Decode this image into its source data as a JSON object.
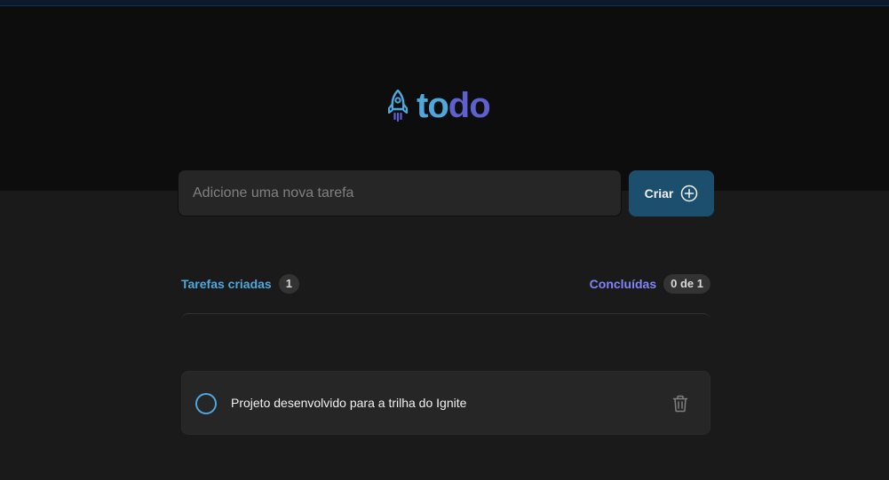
{
  "app": {
    "logo_text_part1": "to",
    "logo_text_part2": "do",
    "logo_icon": "rocket-icon"
  },
  "new_task": {
    "placeholder": "Adicione uma nova tarefa",
    "value": ""
  },
  "create_button": {
    "label": "Criar",
    "icon": "plus-circle-icon"
  },
  "counters": {
    "created_label": "Tarefas criadas",
    "created_count": "1",
    "done_label": "Concluídas",
    "done_count": "0 de 1"
  },
  "tasks": [
    {
      "text": "Projeto desenvolvido para a trilha do Ignite",
      "completed": false,
      "delete_icon": "trash-icon"
    }
  ],
  "colors": {
    "blue": "#4ea8de",
    "purple": "#5e60ce",
    "purple_light": "#8284fa",
    "header_bg": "#0d0d0d",
    "page_bg": "#1a1a1a",
    "card_bg": "#262626",
    "button_bg": "#1c4f6e"
  }
}
